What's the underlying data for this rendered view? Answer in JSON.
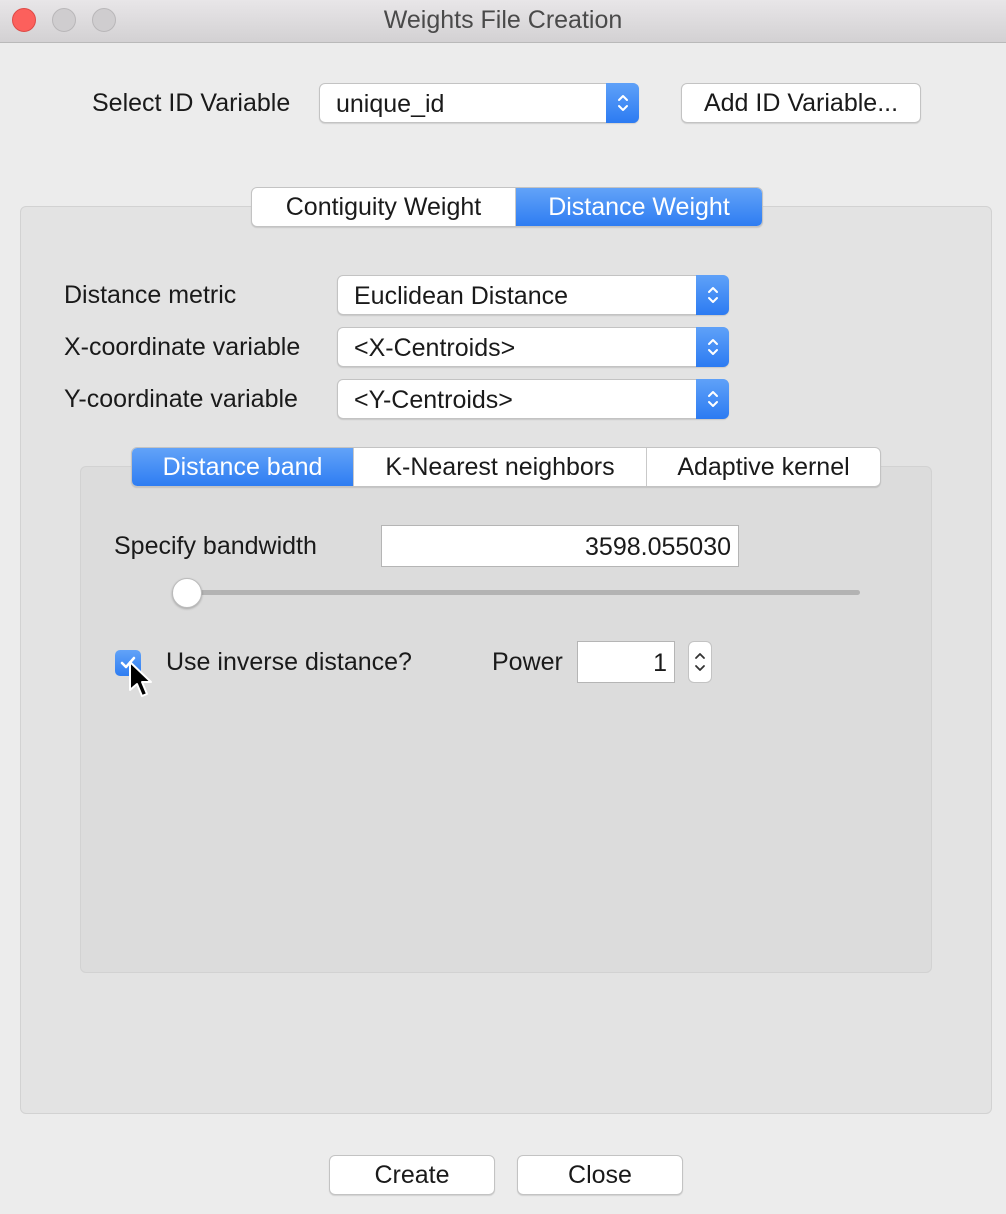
{
  "window": {
    "title": "Weights File Creation"
  },
  "id_variable": {
    "label": "Select ID Variable",
    "selected": "unique_id",
    "add_button": "Add ID Variable..."
  },
  "weight_tabs": [
    {
      "label": "Contiguity Weight",
      "active": false
    },
    {
      "label": "Distance Weight",
      "active": true
    }
  ],
  "distance": {
    "metric_label": "Distance metric",
    "metric_value": "Euclidean Distance",
    "x_label": "X-coordinate variable",
    "x_value": "<X-Centroids>",
    "y_label": "Y-coordinate variable",
    "y_value": "<Y-Centroids>"
  },
  "method_tabs": [
    {
      "label": "Distance band",
      "active": true
    },
    {
      "label": "K-Nearest neighbors",
      "active": false
    },
    {
      "label": "Adaptive kernel",
      "active": false
    }
  ],
  "bandwidth": {
    "label": "Specify bandwidth",
    "value": "3598.055030",
    "slider_fraction": 0.0
  },
  "inverse_distance": {
    "label": "Use inverse distance?",
    "checked": true,
    "power_label": "Power",
    "power_value": "1"
  },
  "footer": {
    "create": "Create",
    "close": "Close"
  },
  "colors": {
    "accent": "#2e7df2",
    "close_button": "#fc605c"
  }
}
